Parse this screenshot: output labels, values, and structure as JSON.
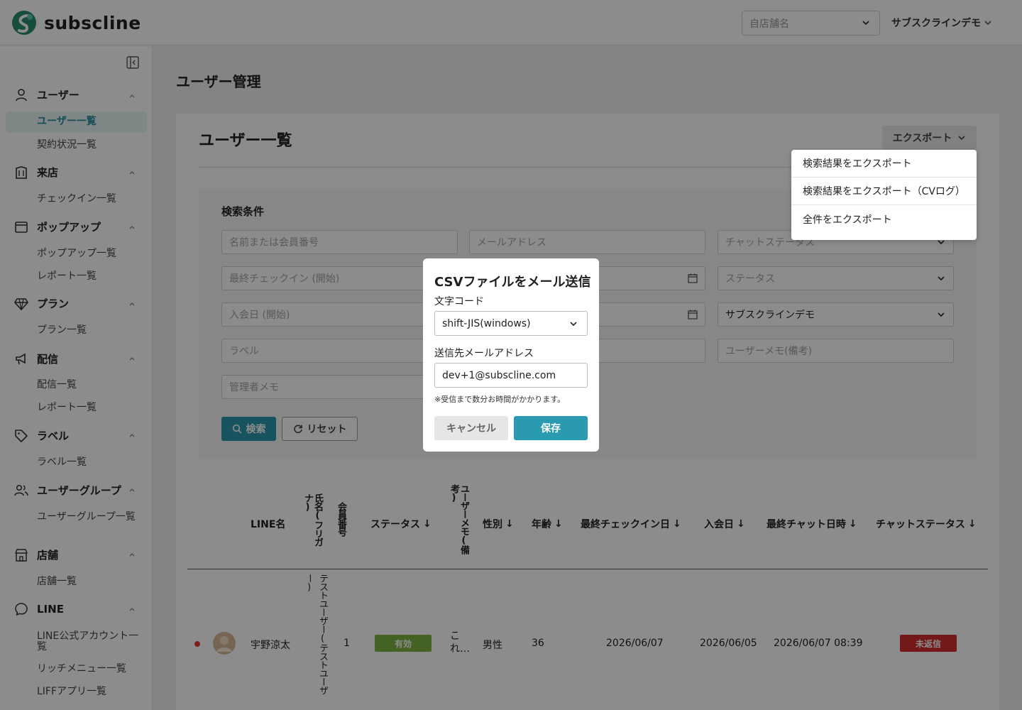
{
  "app": {
    "name": "subscline"
  },
  "header": {
    "store_placeholder": "自店舗名",
    "account_name": "サブスクラインデモ"
  },
  "sidebar": {
    "groups": [
      {
        "label": "ユーザー",
        "icon": "user-icon",
        "items": [
          "ユーザー一覧",
          "契約状況一覧"
        ]
      },
      {
        "label": "来店",
        "icon": "building-icon",
        "items": [
          "チェックイン一覧"
        ]
      },
      {
        "label": "ポップアップ",
        "icon": "window-icon",
        "items": [
          "ポップアップ一覧",
          "レポート一覧"
        ]
      },
      {
        "label": "プラン",
        "icon": "diamond-icon",
        "items": [
          "プラン一覧"
        ]
      },
      {
        "label": "配信",
        "icon": "megaphone-icon",
        "items": [
          "配信一覧",
          "レポート一覧"
        ]
      },
      {
        "label": "ラベル",
        "icon": "tag-icon",
        "items": [
          "ラベル一覧"
        ]
      },
      {
        "label": "ユーザーグループ",
        "icon": "users-icon",
        "items": [
          "ユーザーグループ一覧"
        ]
      },
      {
        "label": "店舗",
        "icon": "store-icon",
        "items": [
          "店舗一覧"
        ]
      },
      {
        "label": "LINE",
        "icon": "chat-bubble-icon",
        "items": [
          "LINE公式アカウント一覧",
          "リッチメニュー一覧",
          "LIFFアプリ一覧"
        ]
      }
    ],
    "active_item": "ユーザー一覧"
  },
  "page": {
    "title": "ユーザー管理",
    "card_title": "ユーザー一覧",
    "export_label": "エクスポート"
  },
  "export_menu": [
    "検索結果をエクスポート",
    "検索結果をエクスポート（CVログ）",
    "全件をエクスポート"
  ],
  "search": {
    "title": "検索条件",
    "fields": {
      "name": "名前または会員番号",
      "email": "メールアドレス",
      "chat_status": "チャットステータス",
      "last_checkin_start": "最終チェックイン (開始)",
      "status": "ステータス",
      "join_start": "入会日 (開始)",
      "account": "サブスクラインデモ",
      "label": "ラベル",
      "user_memo": "ユーザーメモ(備考)",
      "admin_memo": "管理者メモ"
    },
    "search_label": "検索",
    "reset_label": "リセット"
  },
  "table": {
    "headers": {
      "line_name": "LINE名",
      "kana_name": "氏名(フリガナ)",
      "member_no": "会員番号",
      "status": "ステータス",
      "user_memo": "ユーザーメモ(備考)",
      "gender": "性別",
      "age": "年齢",
      "last_checkin": "最終チェックイン日",
      "join_date": "入会日",
      "last_chat": "最終チャット日時",
      "chat_status": "チャットステータス"
    },
    "rows": [
      {
        "line_name": "宇野涼太",
        "kana_name": "テストユーザー(テストユーザー)",
        "member_no": "1",
        "status": "有効",
        "user_memo": "これ…",
        "gender": "男性",
        "age": "36",
        "last_checkin": "2026/06/07",
        "join_date": "2026/06/05",
        "last_chat": "2026/06/07 08:39",
        "chat_status": "未返信"
      }
    ]
  },
  "modal": {
    "title": "CSVファイルをメール送信",
    "encoding_label": "文字コード",
    "encoding_value": "shift-JIS(windows)",
    "email_label": "送信先メールアドレス",
    "email_value": "dev+1@subscline.com",
    "note": "※受信まで数分お時間がかかります。",
    "cancel_label": "キャンセル",
    "save_label": "保存"
  },
  "colors": {
    "accent": "#2a9ab0",
    "active_badge": "#7cb342",
    "unreplied_badge": "#d32f2f",
    "unread_dot": "#e53935"
  }
}
